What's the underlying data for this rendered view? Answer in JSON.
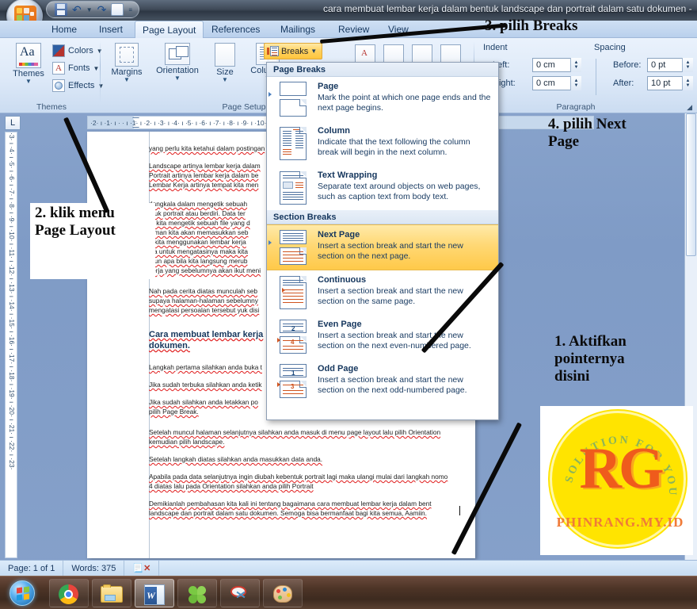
{
  "window": {
    "title": "cara membuat lembar kerja dalam bentuk landscape dan portrait dalam satu dokumen  -  ",
    "quick_access": [
      "save-icon",
      "undo-icon",
      "redo-icon",
      "print-preview-icon",
      "customize-qat-icon"
    ]
  },
  "ribbon": {
    "tabs": [
      {
        "label": "Home",
        "active": false
      },
      {
        "label": "Insert",
        "active": false
      },
      {
        "label": "Page Layout",
        "active": true
      },
      {
        "label": "References",
        "active": false
      },
      {
        "label": "Mailings",
        "active": false
      },
      {
        "label": "Review",
        "active": false
      },
      {
        "label": "View",
        "active": false
      }
    ],
    "groups": [
      {
        "name": "Themes"
      },
      {
        "name": "Page Setup"
      },
      {
        "name": "Paragraph"
      }
    ],
    "themes": {
      "big_label": "Themes",
      "items": [
        {
          "label": "Colors"
        },
        {
          "label": "Fonts"
        },
        {
          "label": "Effects"
        }
      ]
    },
    "page_setup": {
      "buttons": [
        {
          "label": "Margins"
        },
        {
          "label": "Orientation"
        },
        {
          "label": "Size"
        },
        {
          "label": "Columns"
        }
      ],
      "breaks_label": "Breaks"
    },
    "paragraph": {
      "indent_header": "Indent",
      "spacing_header": "Spacing",
      "left_label": "Left:",
      "left_value": "0 cm",
      "right_label": "Right:",
      "right_value": "0 cm",
      "before_label": "Before:",
      "before_value": "0 pt",
      "after_label": "After:",
      "after_value": "10 pt"
    }
  },
  "breaks_menu": {
    "section_page_breaks": "Page Breaks",
    "section_section_breaks": "Section Breaks",
    "items": [
      {
        "title": "Page",
        "accel": "P",
        "desc": "Mark the point at which one page ends and the next page begins.",
        "selected": false,
        "icon": "page-break-icon"
      },
      {
        "title": "Column",
        "accel": "C",
        "desc": "Indicate that the text following the column break will begin in the next column.",
        "selected": false,
        "icon": "column-break-icon"
      },
      {
        "title": "Text Wrapping",
        "accel": "T",
        "desc": "Separate text around objects on web pages, such as caption text from body text.",
        "selected": false,
        "icon": "text-wrapping-break-icon"
      },
      {
        "title": "Next Page",
        "accel": "N",
        "desc": "Insert a section break and start the new section on the next page.",
        "selected": true,
        "icon": "next-page-section-break-icon"
      },
      {
        "title": "Continuous",
        "accel": "o",
        "desc": "Insert a section break and start the new section on the same page.",
        "selected": false,
        "icon": "continuous-section-break-icon"
      },
      {
        "title": "Even Page",
        "accel": "E",
        "desc": "Insert a section break and start the new section on the next even-numbered page.",
        "selected": false,
        "icon": "even-page-section-break-icon"
      },
      {
        "title": "Odd Page",
        "accel": "d",
        "desc": "Insert a section break and start the new section on the next odd-numbered page.",
        "selected": false,
        "icon": "odd-page-section-break-icon"
      }
    ]
  },
  "ruler": {
    "corner_label": "L",
    "horizontal_ticks": "·2· ı ·1· ı ·  · ı ·1· ı ·2· ı ·3· ı ·4· ı ·5· ı ·6· ı ·7· ı ·8· ı ·9· ı ·10· ı ·11· ı ·12· ı ·13· ı ·14· ı ·15· ı ·16· ı ·17· ı ·18· ı ·19",
    "vertical_ticks": "·3· ı ·4· ı ·5· ı ·6· ı ·7· ı ·8· ı ·9· ı ·10· ı ·11· ı ·12· ı ·13· ı ·14· ı ·15· ı ·16· ı ·17· ı ·18· ı ·19· ı ·20· ı ·21· ı ·22· ı ·23·"
  },
  "document": {
    "paragraphs": [
      "yang perlu kita ketahui dalam postingan",
      "Landscape  artinya lembar kerja dalam",
      "Portrait  artinya lembar kerja dalam be",
      "Lembar Kerja artinya tempat kita men",
      "dangkala  dalam  mengetik  sebuah",
      "ntuk  portrait  atau  berdiri.   Data  ter",
      "at  kita  mengetik  sebuah  file  yang  d",
      "laman  kita  akan  memasukkan  seb",
      "a  kita  menggunakan  lembar  kerja",
      "ika  untuk  mengatasinya  maka  kita",
      "mun  apa  bila  kita  langsung  merub",
      "kerja yang sebelumnya akan ikut meni",
      "Nah  pada  cerita  diatas  munculah  seb",
      "supaya  halaman-halaman  sebelumny",
      "mengatasi persoalan  tersebut yuk disi",
      "Cara membuat lembar kerja",
      "dokumen.",
      "Langkah pertama silahkan anda buka t",
      "Jika sudah terbuka silahkan anda ketik",
      "Jika  sudah  silahkan  anda  letakkan  po",
      "pilih Page Break.",
      "Setelah  muncul  halaman  selanjutnya  silahkan  anda  masuk  di  menu  page  layout  lalu  pilih  Orientation",
      "kemudian pilih landscape.",
      "Setelah langkah diatas silahkan anda masukkan data anda.",
      "Apabila  pada  data  selanjutnya  ingin  diubah  kebentuk  portrait  lagi  maka  ulangi  mulai  dari  langkah  nomo",
      "4 diatas lalu pada Orientation  silahkan anda pilih  Portrait",
      "Demikianlah  pembahasan  kita  kali  ini  tentang  bagaimana  cara  membuat  lembar  kerja  dalam  bent",
      "landscape dan portrait dalam satu dokumen.  Semoga bisa bermanfaat bagi kita semua, Aamiin."
    ]
  },
  "annotations": [
    {
      "id": "anno-1",
      "text": "1. Aktifkan\npointernya\ndisini"
    },
    {
      "id": "anno-2",
      "text": "2. klik menu\nPage Layout"
    },
    {
      "id": "anno-3",
      "text": "3. pilih Breaks"
    },
    {
      "id": "anno-4",
      "text": "4. pilih Next\n      Page"
    }
  ],
  "logo": {
    "arc_text": "SOLUTION FOR YOU",
    "monogram": "RG",
    "url": "PHINRANG.MY.ID",
    "bg_color": "#ffe400",
    "letter_color": "#ef5b1c",
    "url_color": "#f07b38"
  },
  "statusbar": {
    "page": "Page: 1 of 1",
    "words": "Words: 375",
    "proofing_icon": "proofing-errors-icon"
  },
  "taskbar": {
    "start": "windows-start-orb",
    "buttons": [
      {
        "name": "chrome-icon"
      },
      {
        "name": "file-explorer-icon"
      },
      {
        "name": "word-icon",
        "active": true
      },
      {
        "name": "clover-icon"
      },
      {
        "name": "snipping-tool-icon"
      },
      {
        "name": "paint-icon"
      }
    ]
  }
}
